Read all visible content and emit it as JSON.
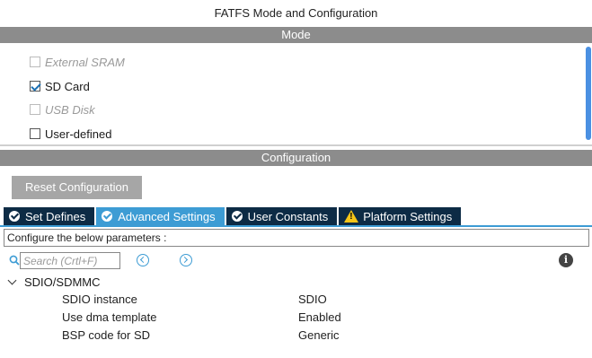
{
  "window": {
    "title": "FATFS Mode and Configuration"
  },
  "mode": {
    "header": "Mode",
    "items": [
      {
        "label": "External SRAM",
        "checked": false,
        "enabled": false
      },
      {
        "label": "SD Card",
        "checked": true,
        "enabled": true
      },
      {
        "label": "USB Disk",
        "checked": false,
        "enabled": false
      },
      {
        "label": "User-defined",
        "checked": false,
        "enabled": true
      }
    ]
  },
  "configuration": {
    "header": "Configuration",
    "reset_label": "Reset Configuration",
    "tabs": [
      {
        "label": "Set Defines",
        "icon": "check-circle-icon",
        "active": false
      },
      {
        "label": "Advanced Settings",
        "icon": "check-circle-icon",
        "active": true
      },
      {
        "label": "User Constants",
        "icon": "check-circle-icon",
        "active": false
      },
      {
        "label": "Platform Settings",
        "icon": "warning-icon",
        "active": false
      }
    ],
    "instructions": "Configure the below parameters :",
    "search": {
      "placeholder": "Search (Crtl+F)",
      "value": ""
    },
    "group": {
      "label": "SDIO/SDMMC",
      "expanded": true,
      "params": [
        {
          "name": "SDIO instance",
          "value": "SDIO"
        },
        {
          "name": "Use dma template",
          "value": "Enabled"
        },
        {
          "name": "BSP code for SD",
          "value": "Generic"
        }
      ]
    }
  },
  "colors": {
    "section_bar": "#8c8c8c",
    "tab_inactive": "#0d2b45",
    "tab_active": "#3d9cd4",
    "scrollbar": "#4a90e2",
    "warning": "#f5c518"
  }
}
